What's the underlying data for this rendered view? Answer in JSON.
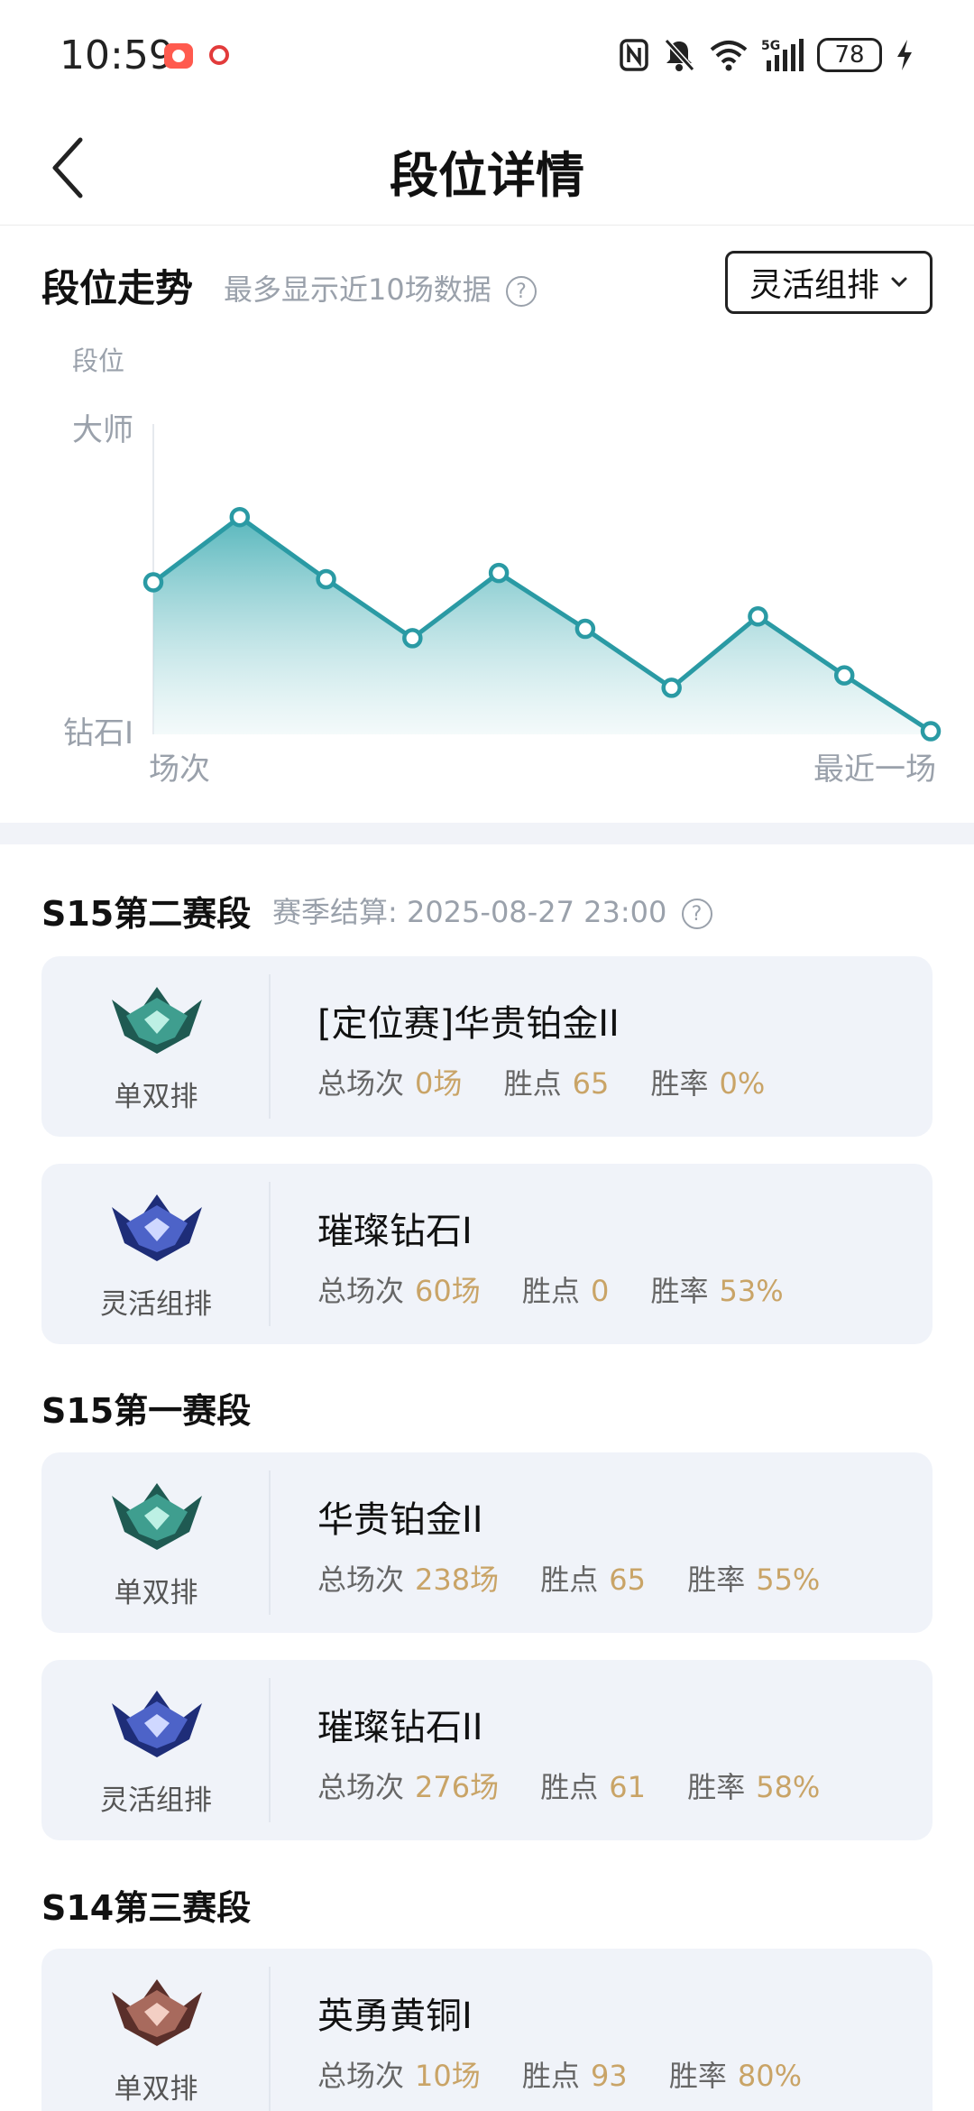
{
  "status_bar": {
    "time": "10:59",
    "network": "5G",
    "battery": "78",
    "icons": [
      "nfc-icon",
      "mute-icon",
      "wifi-icon",
      "signal-icon",
      "charging-icon"
    ]
  },
  "header": {
    "title": "段位详情"
  },
  "trend": {
    "title": "段位走势",
    "note": "最多显示近10场数据",
    "dropdown_label": "灵活组排"
  },
  "chart_data": {
    "type": "line",
    "ylabel": "段位",
    "y_ticks": [
      "大师",
      "钻石I"
    ],
    "x_ticks": [
      "场次",
      "最近一场"
    ],
    "series": [
      {
        "values": [
          0.49,
          0.7,
          0.5,
          0.31,
          0.52,
          0.34,
          0.15,
          0.38,
          0.19,
          0.01
        ]
      }
    ],
    "ylim": [
      0,
      1
    ],
    "colors": {
      "line": "#2a9aa4",
      "fill_top": "#4fb3b9",
      "fill_bottom": "#e8f5f6"
    },
    "grid": false,
    "legend": "none"
  },
  "seasons": [
    {
      "title": "S15第二赛段",
      "settle_label": "赛季结算: 2025-08-27 23:00",
      "cards": [
        {
          "queue": "单双排",
          "emblem": "platinum-emblem",
          "rank": "[定位赛]华贵铂金II",
          "games_label": "总场次",
          "games": "0场",
          "lp_label": "胜点",
          "lp": "65",
          "wr_label": "胜率",
          "wr": "0%"
        },
        {
          "queue": "灵活组排",
          "emblem": "diamond-emblem",
          "rank": "璀璨钻石I",
          "games_label": "总场次",
          "games": "60场",
          "lp_label": "胜点",
          "lp": "0",
          "wr_label": "胜率",
          "wr": "53%"
        }
      ]
    },
    {
      "title": "S15第一赛段",
      "cards": [
        {
          "queue": "单双排",
          "emblem": "platinum-emblem",
          "rank": "华贵铂金II",
          "games_label": "总场次",
          "games": "238场",
          "lp_label": "胜点",
          "lp": "65",
          "wr_label": "胜率",
          "wr": "55%"
        },
        {
          "queue": "灵活组排",
          "emblem": "diamond-emblem",
          "rank": "璀璨钻石II",
          "games_label": "总场次",
          "games": "276场",
          "lp_label": "胜点",
          "lp": "61",
          "wr_label": "胜率",
          "wr": "58%"
        }
      ]
    },
    {
      "title": "S14第三赛段",
      "cards": [
        {
          "queue": "单双排",
          "emblem": "bronze-emblem",
          "rank": "英勇黄铜I",
          "games_label": "总场次",
          "games": "10场",
          "lp_label": "胜点",
          "lp": "93",
          "wr_label": "胜率",
          "wr": "80%"
        }
      ]
    }
  ],
  "colors": {
    "accent": "#2a9aa4",
    "stat_value": "#c9a467",
    "card_bg": "#f0f3f9",
    "muted_text": "#9aa1ab"
  }
}
